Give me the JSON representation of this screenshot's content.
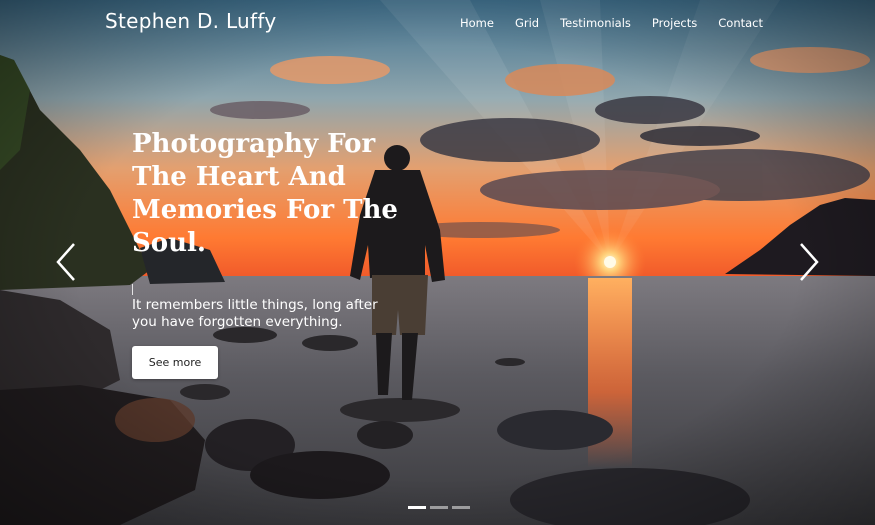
{
  "brand": {
    "name": "Stephen D. Luffy"
  },
  "nav": {
    "items": [
      {
        "label": "Home"
      },
      {
        "label": "Grid"
      },
      {
        "label": "Testimonials"
      },
      {
        "label": "Projects"
      },
      {
        "label": "Contact"
      }
    ]
  },
  "hero": {
    "title": "Photography For The Heart And Memories For The Soul.",
    "subtitle": "It remembers little things, long after you have forgotten everything.",
    "cta_label": "See more"
  },
  "carousel": {
    "prev_icon": "chevron-left-icon",
    "next_icon": "chevron-right-icon",
    "slide_count": 3,
    "active_slide": 1
  },
  "colors": {
    "sky_top": "#4f7f9a",
    "sun_glow": "#ff7a2f",
    "sea": "#5a5a60",
    "button_bg": "#ffffff",
    "text": "#ffffff"
  }
}
